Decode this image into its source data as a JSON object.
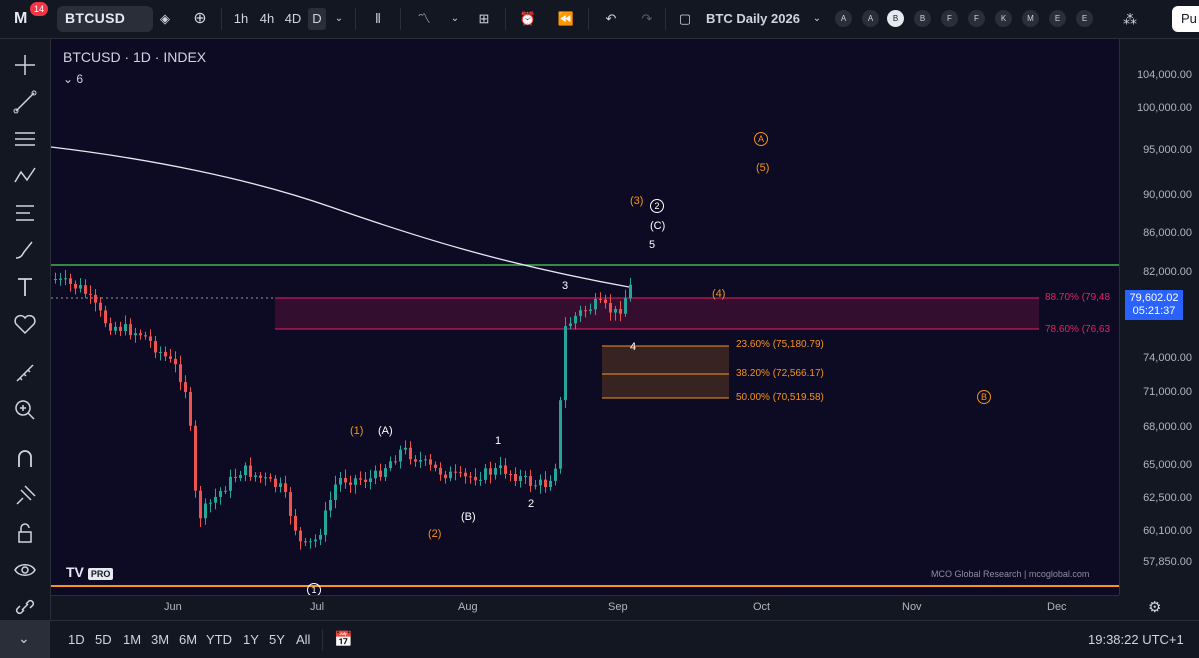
{
  "topbar": {
    "notification_count": "14",
    "symbol": "BTCUSD",
    "intervals": [
      "1h",
      "4h",
      "4D",
      "D"
    ],
    "active_interval": "D",
    "layout_name": "BTC Daily 2026",
    "layout_buttons": [
      "A",
      "A",
      "B",
      "B",
      "F",
      "F",
      "K",
      "M",
      "E",
      "E"
    ],
    "active_layout_button": "B",
    "publish_label": "Pu"
  },
  "chart": {
    "title": "BTCUSD · 1D · INDEX",
    "indicator_count": "6",
    "price_tag": {
      "price": "79,602.02",
      "countdown": "05:21:37"
    },
    "wave_labels": [
      {
        "text": "A",
        "color": "orange",
        "circled": true
      },
      {
        "text": "(5)",
        "color": "orange"
      },
      {
        "text": "(3)",
        "color": "orange"
      },
      {
        "text": "2",
        "color": "white",
        "circled": true
      },
      {
        "text": "(C)",
        "color": "white"
      },
      {
        "text": "5",
        "color": "white"
      },
      {
        "text": "3",
        "color": "white"
      },
      {
        "text": "(4)",
        "color": "orange"
      },
      {
        "text": "4",
        "color": "white"
      },
      {
        "text": "(1)",
        "color": "orange"
      },
      {
        "text": "(A)",
        "color": "white"
      },
      {
        "text": "1",
        "color": "white"
      },
      {
        "text": "2",
        "color": "white"
      },
      {
        "text": "(B)",
        "color": "white"
      },
      {
        "text": "(2)",
        "color": "orange"
      },
      {
        "text": "B",
        "color": "orange",
        "circled": true
      },
      {
        "text": "1",
        "color": "white",
        "circled": true
      }
    ],
    "fib_levels": [
      {
        "label": "88.70% (79,48",
        "color": "#e91e63"
      },
      {
        "label": "78.60% (76,63",
        "color": "#e91e63"
      },
      {
        "label": "23.60% (75,180.79)",
        "color": "#f7931a"
      },
      {
        "label": "38.20% (72,566.17)",
        "color": "#f7931a"
      },
      {
        "label": "50.00% (70,519.58)",
        "color": "#f7931a"
      }
    ],
    "watermark": "MCO Global Research | mcoglobal.com",
    "tv_logo": "TV",
    "tv_pro": "PRO"
  },
  "price_axis": [
    "104,000.00",
    "100,000.00",
    "95,000.00",
    "90,000.00",
    "86,000.00",
    "82,000.00",
    "74,000.00",
    "71,000.00",
    "68,000.00",
    "65,000.00",
    "62,500.00",
    "60,100.00",
    "57,850.00"
  ],
  "time_axis": [
    "Jun",
    "Jul",
    "Aug",
    "Sep",
    "Oct",
    "Nov",
    "Dec"
  ],
  "bottombar": {
    "ranges": [
      "1D",
      "5D",
      "1M",
      "3M",
      "6M",
      "YTD",
      "1Y",
      "5Y",
      "All"
    ],
    "clock": "19:38:22 UTC+1"
  },
  "colors": {
    "chart_bg": "#0d0b24",
    "up": "#26a69a",
    "down": "#ef5350",
    "ma_line": "#ffffff",
    "fib_pink": "#e91e63",
    "fib_orange": "#f7931a",
    "hline_green": "#4caf50"
  }
}
